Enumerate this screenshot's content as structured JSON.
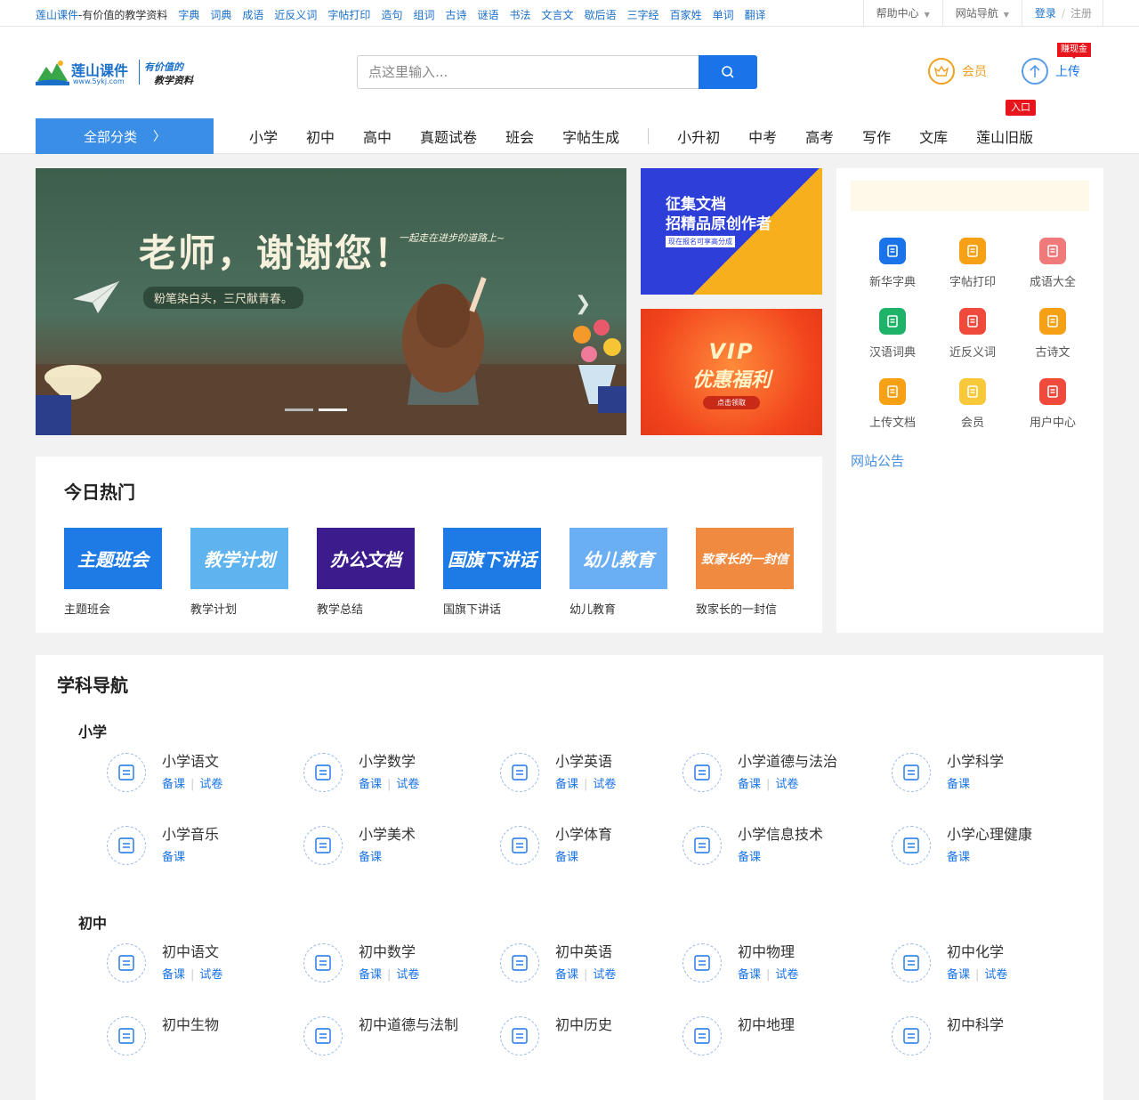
{
  "topbar": {
    "brand": "莲山课件",
    "slogan": "-有价值的教学资料",
    "quick_links": [
      "字典",
      "词典",
      "成语",
      "近反义词",
      "字帖打印",
      "造句",
      "组词",
      "古诗",
      "谜语",
      "书法",
      "文言文",
      "歇后语",
      "三字经",
      "百家姓",
      "单词",
      "翻译"
    ],
    "help": "帮助中心",
    "site_nav": "网站导航",
    "login": "登录",
    "register": "注册"
  },
  "header": {
    "logo_name": "莲山课件",
    "logo_url": "www.5ykj.com",
    "logo_tag1": "有价值的",
    "logo_tag2": "教学资料",
    "search_placeholder": "点这里输入...",
    "vip": "会员",
    "upload": "上传",
    "badge_earn": "赚现金",
    "badge_entry": "入口"
  },
  "nav": {
    "all_categories": "全部分类",
    "group1": [
      "小学",
      "初中",
      "高中",
      "真题试卷",
      "班会",
      "字帖生成"
    ],
    "group2": [
      "小升初",
      "中考",
      "高考",
      "写作",
      "文库",
      "莲山旧版"
    ]
  },
  "banner": {
    "title": "老师，谢谢您！",
    "sub": "一起走在进步的道路上~",
    "chip": "粉笔染白头，三尺献青春。"
  },
  "ads": {
    "ad1_line1": "征集文档",
    "ad1_line2": "招精品原创作者",
    "ad1_line3": "现在报名可享高分成",
    "ad2_line1": "VIP",
    "ad2_line2": "优惠福利",
    "ad2_cta": "点击领取"
  },
  "sidebar": {
    "tools": [
      {
        "label": "新华字典",
        "color": "#1a73e8"
      },
      {
        "label": "字帖打印",
        "color": "#f5a015"
      },
      {
        "label": "成语大全",
        "color": "#f07a7a"
      },
      {
        "label": "汉语词典",
        "color": "#1fb36a"
      },
      {
        "label": "近反义词",
        "color": "#ef4a3c"
      },
      {
        "label": "古诗文",
        "color": "#f5a015"
      },
      {
        "label": "上传文档",
        "color": "#f5a015"
      },
      {
        "label": "会员",
        "color": "#f7c93a"
      },
      {
        "label": "用户中心",
        "color": "#ef4a3c"
      }
    ],
    "announcement": "网站公告"
  },
  "hot": {
    "title": "今日热门",
    "items": [
      {
        "label": "主题班会",
        "img_text": "主题班会",
        "color": "#1e7be6"
      },
      {
        "label": "教学计划",
        "img_text": "教学计划",
        "color": "#5fb4f0"
      },
      {
        "label": "教学总结",
        "img_text": "办公文档",
        "color": "#3c1c8c"
      },
      {
        "label": "国旗下讲话",
        "img_text": "国旗下讲话",
        "color": "#1e7be6"
      },
      {
        "label": "幼儿教育",
        "img_text": "幼儿教育",
        "color": "#6aaef3"
      },
      {
        "label": "致家长的一封信",
        "img_text": "致家长的一封信",
        "color": "#f08a40"
      }
    ]
  },
  "subjects": {
    "title": "学科导航",
    "levels": [
      {
        "name": "小学",
        "items": [
          {
            "name": "小学语文",
            "links": [
              "备课",
              "试卷"
            ]
          },
          {
            "name": "小学数学",
            "links": [
              "备课",
              "试卷"
            ]
          },
          {
            "name": "小学英语",
            "links": [
              "备课",
              "试卷"
            ]
          },
          {
            "name": "小学道德与法治",
            "links": [
              "备课",
              "试卷"
            ]
          },
          {
            "name": "小学科学",
            "links": [
              "备课"
            ]
          },
          {
            "name": "小学音乐",
            "links": [
              "备课"
            ]
          },
          {
            "name": "小学美术",
            "links": [
              "备课"
            ]
          },
          {
            "name": "小学体育",
            "links": [
              "备课"
            ]
          },
          {
            "name": "小学信息技术",
            "links": [
              "备课"
            ]
          },
          {
            "name": "小学心理健康",
            "links": [
              "备课"
            ]
          }
        ]
      },
      {
        "name": "初中",
        "items": [
          {
            "name": "初中语文",
            "links": [
              "备课",
              "试卷"
            ]
          },
          {
            "name": "初中数学",
            "links": [
              "备课",
              "试卷"
            ]
          },
          {
            "name": "初中英语",
            "links": [
              "备课",
              "试卷"
            ]
          },
          {
            "name": "初中物理",
            "links": [
              "备课",
              "试卷"
            ]
          },
          {
            "name": "初中化学",
            "links": [
              "备课",
              "试卷"
            ]
          },
          {
            "name": "初中生物",
            "links": []
          },
          {
            "name": "初中道德与法制",
            "links": []
          },
          {
            "name": "初中历史",
            "links": []
          },
          {
            "name": "初中地理",
            "links": []
          },
          {
            "name": "初中科学",
            "links": []
          }
        ]
      }
    ]
  }
}
